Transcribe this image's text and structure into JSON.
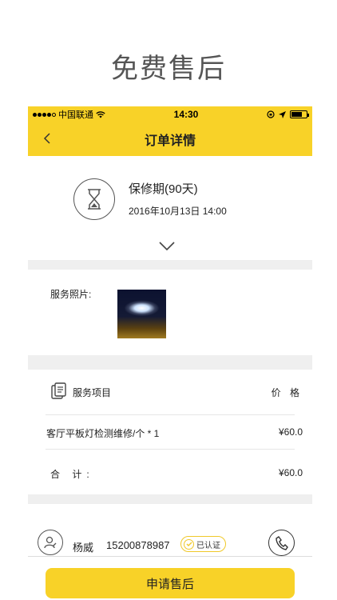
{
  "page_title": "免费售后",
  "status_bar": {
    "carrier": "中国联通",
    "time": "14:30"
  },
  "nav": {
    "title": "订单详情"
  },
  "warranty": {
    "title": "保修期(90天)",
    "date": "2016年10月13日 14:00"
  },
  "photos": {
    "label": "服务照片:"
  },
  "services": {
    "header_label": "服务项目",
    "price_label": "价 格",
    "items": [
      {
        "name": "客厅平板灯检测维修/个  * 1",
        "price": "¥60.0"
      }
    ],
    "total_label": "合 计:",
    "total_value": "¥60.0"
  },
  "contact": {
    "name": "杨威",
    "phone": "15200878987",
    "badge": "已认证"
  },
  "action": {
    "apply_label": "申请售后"
  },
  "colors": {
    "brand_yellow": "#f8d228",
    "separator": "#efefef"
  }
}
